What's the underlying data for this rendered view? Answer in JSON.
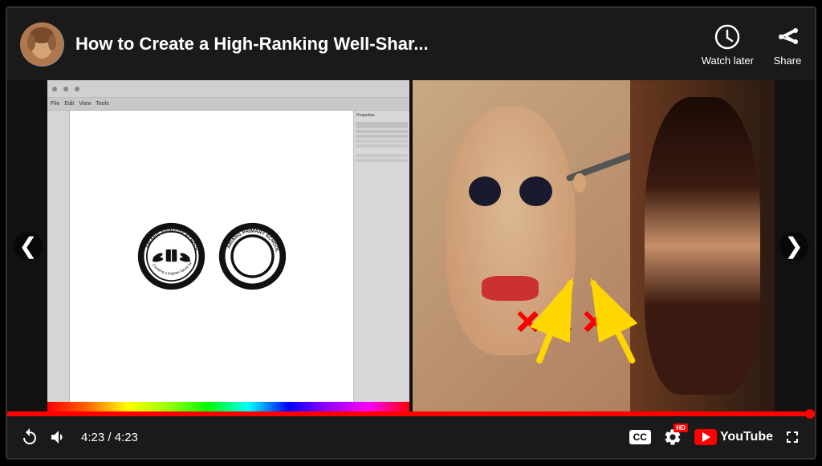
{
  "player": {
    "title": "How to Create a High-Ranking Well-Shar...",
    "time_current": "4:23",
    "time_total": "4:23",
    "time_display": "4:23 / 4:23"
  },
  "top_bar": {
    "watch_later_label": "Watch later",
    "share_label": "Share"
  },
  "nav": {
    "left_arrow": "❮",
    "right_arrow": "❯"
  },
  "controls": {
    "cc_label": "CC",
    "hd_label": "HD",
    "youtube_label": "YouTube"
  }
}
